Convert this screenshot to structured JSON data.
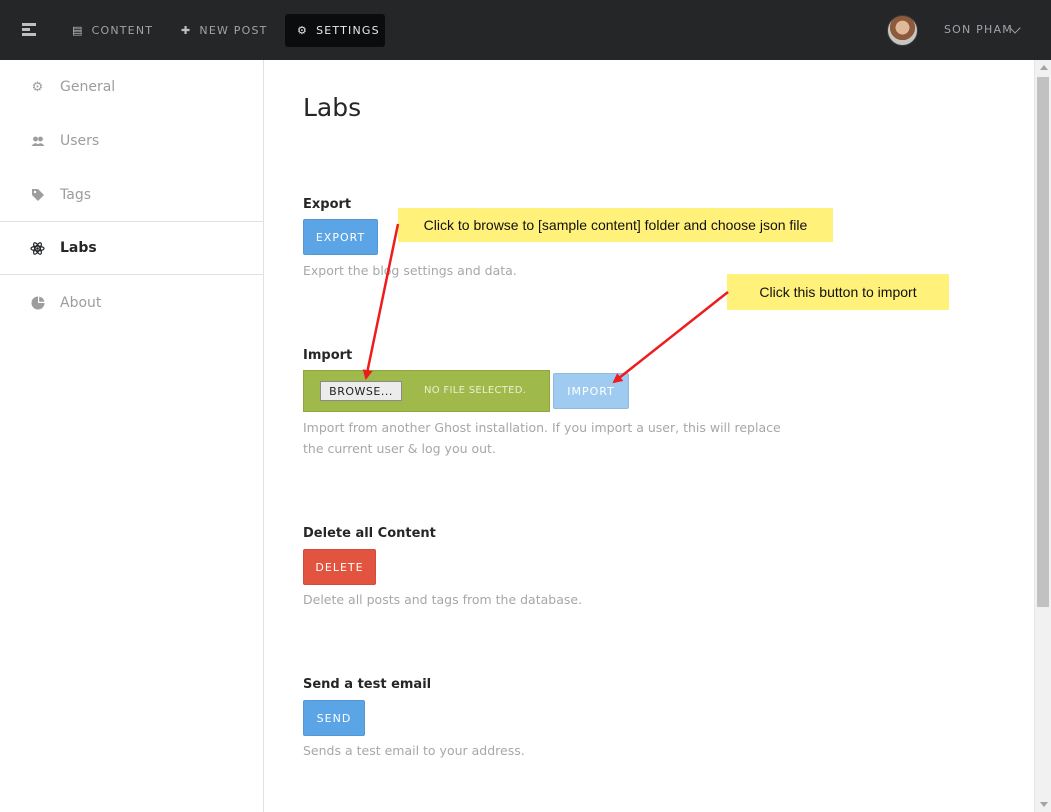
{
  "topnav": {
    "content_label": "CONTENT",
    "content_icon": "content-icon",
    "newpost_label": "NEW POST",
    "newpost_icon": "plus-icon",
    "settings_label": "SETTINGS",
    "settings_icon": "gears-icon",
    "user_name": "SON PHAM"
  },
  "sidebar": {
    "items": [
      {
        "label": "General",
        "icon": "gear-icon"
      },
      {
        "label": "Users",
        "icon": "users-icon"
      },
      {
        "label": "Tags",
        "icon": "tag-icon"
      },
      {
        "label": "Labs",
        "icon": "atom-icon",
        "active": true
      },
      {
        "label": "About",
        "icon": "ghost-icon"
      }
    ]
  },
  "main": {
    "title": "Labs",
    "export": {
      "label": "Export",
      "button": "EXPORT",
      "help": "Export the blog settings and data."
    },
    "import": {
      "label": "Import",
      "browse_button": "BROWSE...",
      "file_status": "NO FILE SELECTED.",
      "button": "IMPORT",
      "help": "Import from another Ghost installation. If you import a user, this will replace the current user & log you out."
    },
    "delete": {
      "label": "Delete all Content",
      "button": "DELETE",
      "help": "Delete all posts and tags from the database."
    },
    "email": {
      "label": "Send a test email",
      "button": "SEND",
      "help": "Sends a test email to your address."
    }
  },
  "annotations": {
    "note1": "Click to browse to [sample content] folder and choose json file",
    "note2": "Click this button to import"
  },
  "colors": {
    "nav_bg": "#242628",
    "blue": "#5ba4e5",
    "red": "#e25440",
    "green": "#9fba4b",
    "note": "#fff17a",
    "arrow": "#ee1c1c"
  }
}
